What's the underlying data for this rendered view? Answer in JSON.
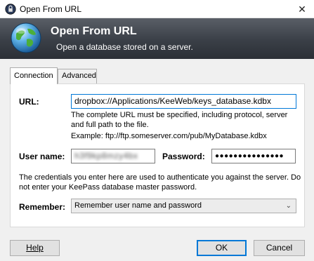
{
  "window": {
    "title": "Open From URL",
    "close_glyph": "✕"
  },
  "banner": {
    "title": "Open From URL",
    "subtitle": "Open a database stored on a server."
  },
  "tabs": [
    {
      "label": "Connection",
      "active": true
    },
    {
      "label": "Advanced",
      "active": false
    }
  ],
  "form": {
    "url_label": "URL:",
    "url_value": "dropbox://Applications/KeeWeb/keys_database.kdbx",
    "url_help_line1": "The complete URL must be specified, including protocol, server",
    "url_help_line2": "and full path to the file.",
    "url_example": "Example: ftp://ftp.someserver.com/pub/MyDatabase.kdbx",
    "username_label": "User name:",
    "username_value": "h3f9kp8mzy4bx",
    "password_label": "Password:",
    "password_value": "●●●●●●●●●●●●●●●",
    "credentials_note_line1": "The credentials you enter here are used to authenticate you against the server. Do",
    "credentials_note_line2": "not enter your KeePass database master password.",
    "remember_label": "Remember:",
    "remember_value": "Remember user name and password"
  },
  "buttons": {
    "help": "Help",
    "ok": "OK",
    "cancel": "Cancel"
  },
  "icons": {
    "app": "keepass-lock-icon",
    "banner": "globe-icon",
    "dropdown": "chevron-down-icon"
  },
  "colors": {
    "banner_top": "#5a5f67",
    "banner_bottom": "#2b2f36",
    "focus_border": "#0078d7"
  }
}
